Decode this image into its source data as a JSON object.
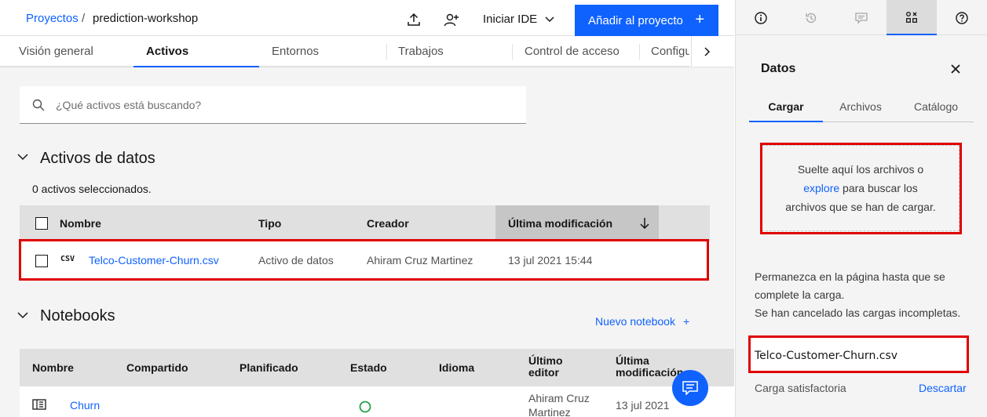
{
  "breadcrumb": {
    "root": "Proyectos",
    "separator": "/",
    "current": "prediction-workshop"
  },
  "header": {
    "launch_ide": "Iniciar IDE",
    "add_to_project": "Añadir al proyecto"
  },
  "tabs": [
    "Visión general",
    "Activos",
    "Entornos",
    "Trabajos",
    "Control de acceso",
    "Configu"
  ],
  "search": {
    "placeholder": "¿Qué activos está buscando?"
  },
  "data_assets": {
    "title": "Activos de datos",
    "selected_count": "0 activos seleccionados.",
    "columns": [
      "Nombre",
      "Tipo",
      "Creador",
      "Última modificación"
    ],
    "rows": [
      {
        "badge": "CSV",
        "name": "Telco-Customer-Churn.csv",
        "type": "Activo de datos",
        "creator": "Ahiram Cruz Martinez",
        "modified": "13 jul 2021 15:44"
      }
    ]
  },
  "notebooks": {
    "title": "Notebooks",
    "new_label": "Nuevo notebook",
    "columns": [
      "Nombre",
      "Compartido",
      "Planificado",
      "Estado",
      "Idioma",
      "Último editor",
      "Última modificación"
    ],
    "rows": [
      {
        "name": "Churn",
        "editor": "Ahiram Cruz Martinez",
        "modified": "13 jul 2021"
      }
    ]
  },
  "panel": {
    "title": "Datos",
    "tabs": [
      "Cargar",
      "Archivos",
      "Catálogo"
    ],
    "drop_text_1": "Suelte aquí los archivos o",
    "drop_link": "explore",
    "drop_text_2": " para buscar los",
    "drop_text_3": "archivos que se han de cargar.",
    "info_1": "Permanezca en la página hasta que se",
    "info_2": "complete la carga.",
    "info_3": "Se han cancelado las cargas incompletas.",
    "file_name": "Telco-Customer-Churn.csv",
    "upload_status": "Carga satisfactoria",
    "download": "Descartar"
  },
  "colors": {
    "accent": "#0f62fe",
    "highlight": "#e00000",
    "status_ok": "#24a148"
  }
}
